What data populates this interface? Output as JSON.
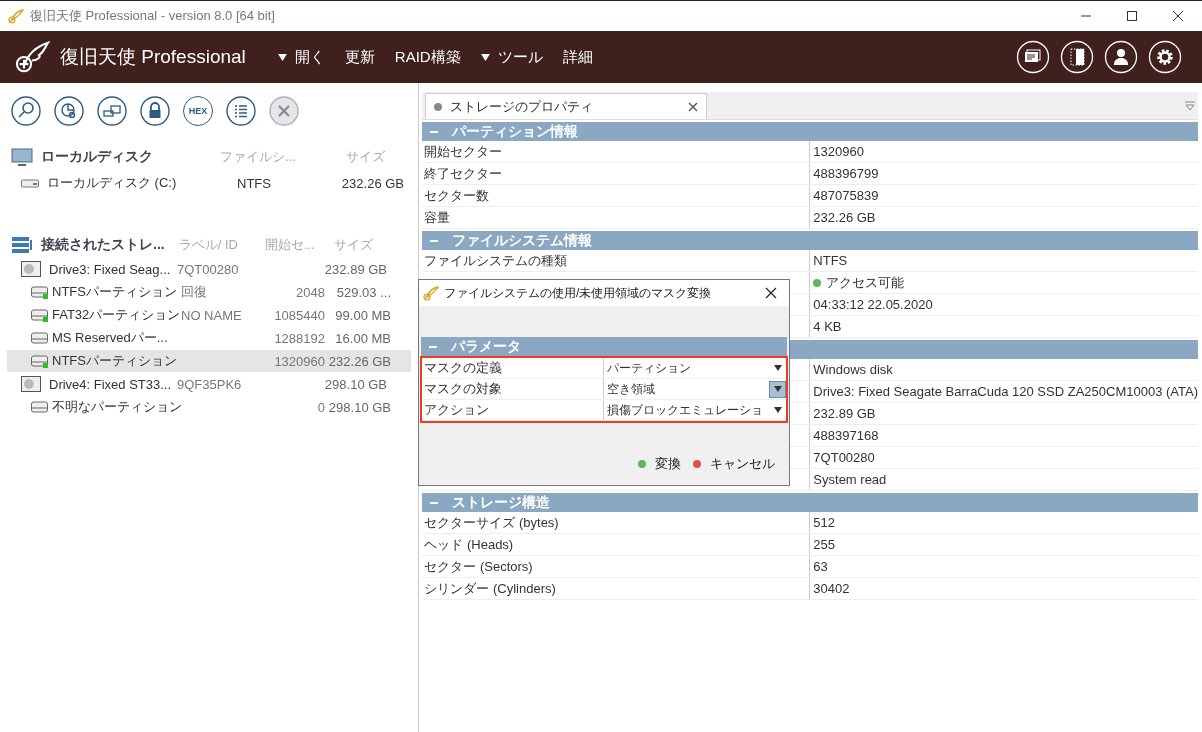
{
  "window": {
    "title": "復旧天使 Professional - version 8.0 [64 bit]"
  },
  "app": {
    "name": "復旧天使 Professional"
  },
  "menu": [
    {
      "label": "開く",
      "caret": true
    },
    {
      "label": "更新",
      "caret": false
    },
    {
      "label": "RAID構築",
      "caret": false
    },
    {
      "label": "ツール",
      "caret": true
    },
    {
      "label": "詳細",
      "caret": false
    }
  ],
  "header_buttons": [
    {
      "kind": "cards"
    },
    {
      "kind": "panel"
    },
    {
      "kind": "user"
    },
    {
      "kind": "settings"
    }
  ],
  "toolbar": [
    {
      "kind": "search",
      "disabled": false
    },
    {
      "kind": "chart",
      "disabled": false
    },
    {
      "kind": "drives",
      "disabled": false
    },
    {
      "kind": "lock",
      "disabled": false
    },
    {
      "kind": "hex",
      "label": "HEX",
      "disabled": false
    },
    {
      "kind": "list",
      "disabled": false
    },
    {
      "kind": "close",
      "disabled": true
    }
  ],
  "local_disks": {
    "title": "ローカルディスク",
    "columns": [
      "ファイルシ...",
      "サイズ"
    ],
    "items": [
      {
        "name": "ローカルディスク (C:)",
        "fs": "NTFS",
        "size": "232.26 GB"
      }
    ]
  },
  "storages": {
    "title": "接続されたストレ...",
    "columns": [
      "ラベル/ ID",
      "開始セ...",
      "サイズ"
    ],
    "items": [
      {
        "kind": "drive",
        "name": "Drive3: Fixed Seag...",
        "label": "7QT00280",
        "size": "232.89 GB",
        "selected": false,
        "children": [
          {
            "kind": "partition",
            "name": "NTFSパーティション",
            "label": "回復",
            "start": "2048",
            "size": "529.03 ...",
            "mounted": true,
            "selected": false
          },
          {
            "kind": "partition",
            "name": "FAT32パーティション",
            "label": "NO NAME",
            "start": "1085440",
            "size": "99.00 MB",
            "mounted": true,
            "selected": false
          },
          {
            "kind": "partition",
            "name": "MS Reservedパー...",
            "start": "1288192",
            "size": "16.00 MB",
            "mounted": false,
            "selected": false
          },
          {
            "kind": "partition",
            "name": "NTFSパーティション",
            "start": "1320960",
            "size": "232.26 GB",
            "mounted": true,
            "selected": true
          }
        ]
      },
      {
        "kind": "drive",
        "name": "Drive4: Fixed ST33...",
        "label": "9QF35PK6",
        "size": "298.10 GB",
        "selected": false,
        "children": [
          {
            "kind": "partition",
            "name": "不明なパーティション",
            "start": "0",
            "size": "298.10 GB",
            "mounted": false,
            "selected": false
          }
        ]
      }
    ]
  },
  "tab": {
    "label": "ストレージのプロパティ",
    "selected": true
  },
  "sections": [
    {
      "title": "パーティション情報",
      "rows": [
        {
          "label": "開始セクター",
          "value": "1320960"
        },
        {
          "label": "終了セクター",
          "value": "488396799"
        },
        {
          "label": "セクター数",
          "value": "487075839"
        },
        {
          "label": "容量",
          "value": "232.26 GB"
        }
      ]
    },
    {
      "title": "ファイルシステム情報",
      "rows": [
        {
          "label": "ファイルシステムの種類",
          "value": "NTFS"
        },
        {
          "value": "アクセス可能",
          "color": "#5cb85c"
        },
        {
          "value": "04:33:12 22.05.2020"
        },
        {
          "value": "4 KB"
        }
      ]
    },
    {
      "rows": [
        {
          "value": "Windows disk"
        },
        {
          "value": "Drive3: Fixed Seagate BarraCuda 120 SSD ZA250CM10003 (ATA)"
        },
        {
          "value": "232.89 GB"
        },
        {
          "value": "488397168"
        },
        {
          "value": "7QT00280"
        },
        {
          "value": "System read"
        }
      ]
    },
    {
      "title": "ストレージ構造",
      "rows": [
        {
          "label": "セクターサイズ (bytes)",
          "value": "512"
        },
        {
          "label": "ヘッド (Heads)",
          "value": "255"
        },
        {
          "label": "セクター (Sectors)",
          "value": "63"
        },
        {
          "label": "シリンダー (Cylinders)",
          "value": "30402"
        }
      ]
    }
  ],
  "dialog": {
    "title": "ファイルシステムの使用/未使用領域のマスク変換",
    "section": "パラメータ",
    "params": [
      {
        "label": "マスクの定義",
        "value": "パーティション",
        "selected": false
      },
      {
        "label": "マスクの対象",
        "value": "空き領域",
        "selected": true
      },
      {
        "label": "アクション",
        "value": "損傷ブロックエミュレーショ",
        "selected": false
      }
    ],
    "buttons": [
      {
        "label": "変換",
        "color": "#5cb85c"
      },
      {
        "label": "キャンセル",
        "color": "#d9534f"
      }
    ]
  }
}
